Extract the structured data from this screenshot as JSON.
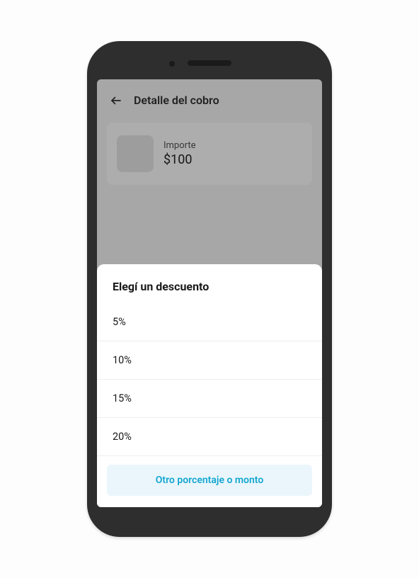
{
  "page": {
    "title": "Detalle del cobro"
  },
  "charge": {
    "label": "Importe",
    "amount": "$100"
  },
  "sheet": {
    "title": "Elegí un descuento",
    "options": [
      "5%",
      "10%",
      "15%",
      "20%"
    ],
    "other_label": "Otro porcentaje o monto"
  }
}
